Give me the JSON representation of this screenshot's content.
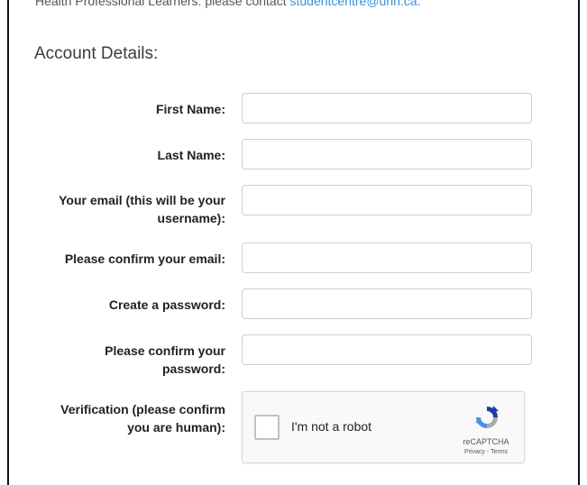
{
  "notice": {
    "text": "Health Professional Learners: please contact ",
    "email": "studentcentre@unn.ca."
  },
  "section_title": "Account Details:",
  "fields": [
    {
      "label": "First Name:",
      "value": ""
    },
    {
      "label": "Last Name:",
      "value": ""
    },
    {
      "label": "Your email (this will be your username):",
      "value": ""
    },
    {
      "label": "Please confirm your email:",
      "value": ""
    },
    {
      "label": "Create a password:",
      "value": ""
    },
    {
      "label": "Please confirm your password:",
      "value": ""
    }
  ],
  "verification": {
    "label": "Verification (please confirm you are human):",
    "checkbox_label": "I'm not a robot",
    "brand": "reCAPTCHA",
    "links": "Privacy - Terms",
    "icon": "recaptcha-icon",
    "checked": false
  },
  "colors": {
    "link": "#3a8fd9",
    "input_border": "#cfcfcf",
    "recaptcha_blue": "#1c3aa9",
    "recaptcha_light": "#4a90e2"
  }
}
